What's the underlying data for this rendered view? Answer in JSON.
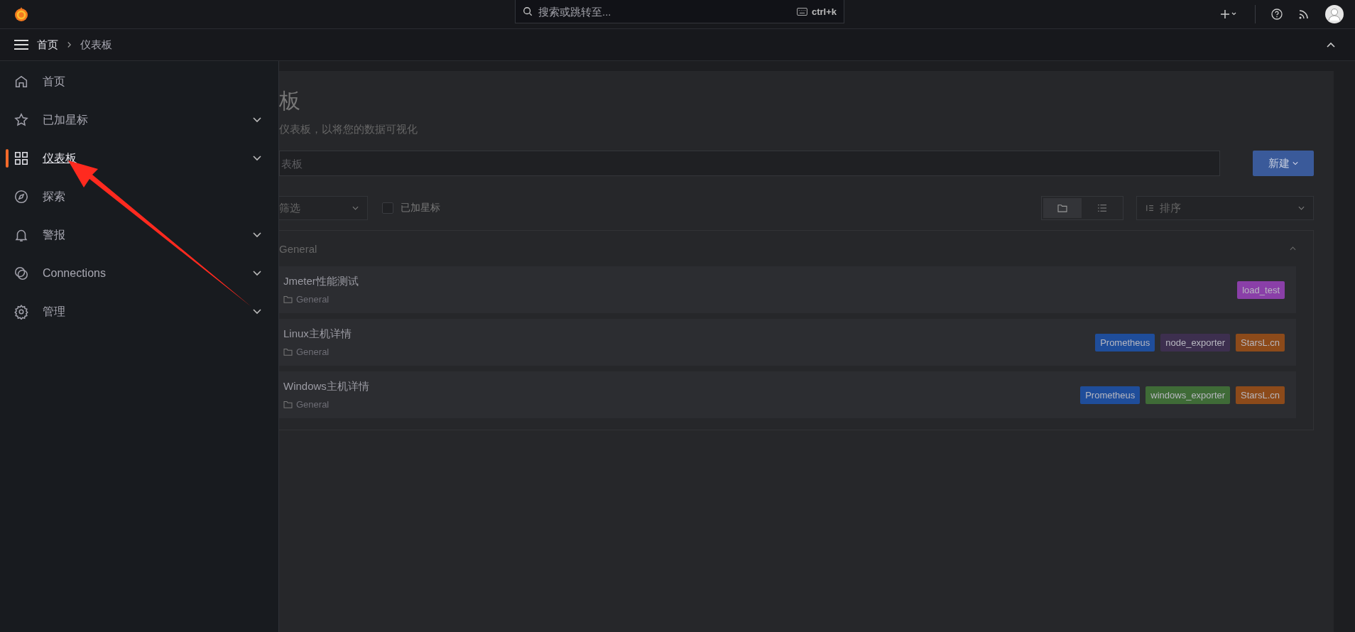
{
  "topbar": {
    "search": {
      "placeholder": "搜索或跳转至...",
      "shortcut": "ctrl+k"
    }
  },
  "breadcrumb": [
    "首页",
    "仪表板"
  ],
  "sidebar": {
    "items": [
      {
        "label": "首页",
        "selected": false
      },
      {
        "label": "已加星标",
        "selected": false,
        "expanded": false
      },
      {
        "label": "仪表板",
        "selected": true,
        "expanded": false
      },
      {
        "label": "探索",
        "selected": false
      },
      {
        "label": "警报",
        "selected": false,
        "expanded": false
      },
      {
        "label": "Connections",
        "selected": false,
        "expanded": false
      },
      {
        "label": "管理",
        "selected": false,
        "expanded": false
      }
    ]
  },
  "page": {
    "title": "板",
    "subtitle": "仪表板，以将您的数据可视化",
    "search": {
      "placeholder": "表板"
    },
    "new_button": "新建",
    "filter": "筛选",
    "starred": {
      "label": "已加星标",
      "checked": false
    },
    "views": [
      {
        "selected": true
      },
      {
        "selected": false
      }
    ],
    "sort": "排序",
    "folder": {
      "name": "General",
      "expanded": true,
      "dashboards": [
        {
          "title": "Jmeter性能测试",
          "folder": "General",
          "tags": [
            {
              "label": "load_test",
              "color": "#8a3fa8"
            }
          ]
        },
        {
          "title": "Linux主机详情",
          "folder": "General",
          "tags": [
            {
              "label": "Prometheus",
              "color": "#1f4d9a"
            },
            {
              "label": "node_exporter",
              "color": "#3d2f4f"
            },
            {
              "label": "StarsL.cn",
              "color": "#8c4a1a"
            }
          ]
        },
        {
          "title": "Windows主机详情",
          "folder": "General",
          "tags": [
            {
              "label": "Prometheus",
              "color": "#1f4d9a"
            },
            {
              "label": "windows_exporter",
              "color": "#3f6b37"
            },
            {
              "label": "StarsL.cn",
              "color": "#8c4a1a"
            }
          ]
        }
      ]
    }
  }
}
